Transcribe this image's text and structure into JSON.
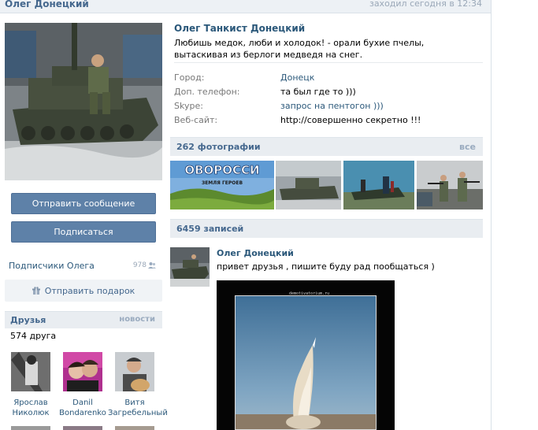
{
  "header": {
    "name": "Олег Донецкий",
    "online": "заходил сегодня в 12:34"
  },
  "left": {
    "send_message": "Отправить сообщение",
    "subscribe": "Подписаться",
    "subscribers_label": "Подписчики Олега",
    "subscribers_count": "978",
    "gift": "Отправить подарок",
    "friends_title": "Друзья",
    "friends_news": "новости",
    "friends_count": "574 друга",
    "friends": [
      {
        "first": "Ярослав",
        "last": "Николюк"
      },
      {
        "first": "Danil",
        "last": "Bondarenko"
      },
      {
        "first": "Витя",
        "last": "Загребельный"
      }
    ]
  },
  "profile": {
    "full_name": "Олег Танкист Донецкий",
    "status": "Любишь медок, люби и холодок! - орали бухие пчелы, вытаскивая из берлоги медведя на снег.",
    "info": [
      {
        "label": "Город:",
        "value": "Донецк",
        "link": true
      },
      {
        "label": "Доп. телефон:",
        "value": "та был где то )))",
        "link": false
      },
      {
        "label": "Skype:",
        "value": "запрос на пентогон )))",
        "link": true
      },
      {
        "label": "Веб-сайт:",
        "value": "http://совершенно секретно !!!",
        "link": false
      }
    ]
  },
  "photos": {
    "title": "262 фотографии",
    "all": "все",
    "banner_big": "ОВОРОССИ",
    "banner_small": "ЗЕМЛЯ ГЕРОЕВ"
  },
  "wall": {
    "title": "6459 записей",
    "post_author": "Олег Донецкий",
    "post_text": "привет друзья , пишите буду рад пообщаться )",
    "image_caption": "demotivatorium.ru"
  },
  "colors": {
    "link": "#2b587a",
    "header_text": "#45688e",
    "button": "#5e81a8",
    "section_bg": "#e9edf1",
    "muted": "#9aabbf"
  }
}
